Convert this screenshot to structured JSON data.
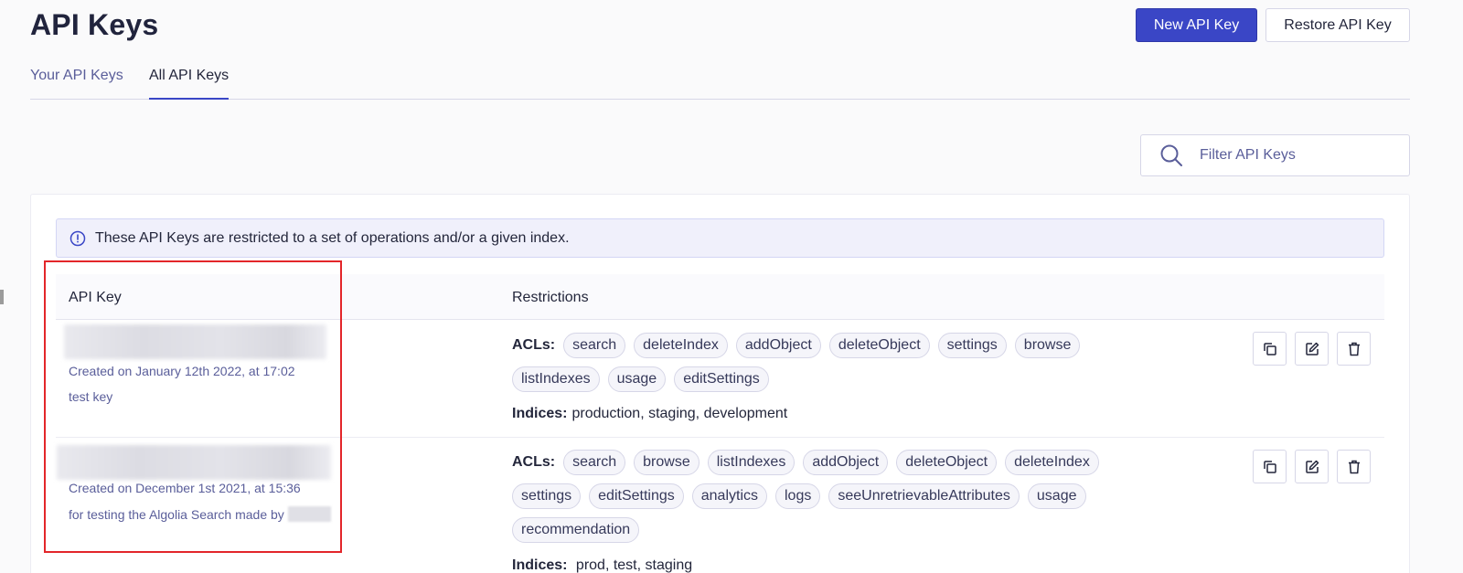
{
  "header": {
    "title": "API Keys",
    "new_key_label": "New API Key",
    "restore_key_label": "Restore API Key"
  },
  "tabs": [
    {
      "label": "Your API Keys",
      "active": false
    },
    {
      "label": "All API Keys",
      "active": true
    }
  ],
  "search": {
    "placeholder": "Filter API Keys",
    "value": ""
  },
  "notice": "These API Keys are restricted to a set of operations and/or a given index.",
  "table": {
    "columns": [
      "API Key",
      "Restrictions"
    ],
    "rows": [
      {
        "created": "Created on January 12th 2022, at 17:02",
        "description": "test key",
        "acl_label": "ACLs:",
        "acl_lines": [
          [
            "search",
            "deleteIndex",
            "addObject",
            "deleteObject",
            "settings",
            "browse"
          ],
          [
            "listIndexes",
            "usage",
            "editSettings"
          ]
        ],
        "indices_label": "Indices:",
        "indices": "production, staging, development"
      },
      {
        "created": "Created on December 1st 2021, at 15:36",
        "description": "for testing the Algolia Search made by",
        "acl_label": "ACLs:",
        "acl_lines": [
          [
            "search",
            "browse",
            "listIndexes",
            "addObject",
            "deleteObject",
            "deleteIndex"
          ],
          [
            "settings",
            "editSettings",
            "analytics",
            "logs",
            "seeUnretrievableAttributes",
            "usage"
          ],
          [
            "recommendation"
          ]
        ],
        "indices_label": "Indices:",
        "indices": "prod, test, staging"
      }
    ]
  },
  "colors": {
    "primary": "#3a46c6",
    "highlight": "#e3262a"
  },
  "icons": [
    "search-icon",
    "info-icon",
    "copy-icon",
    "edit-icon",
    "delete-icon"
  ]
}
